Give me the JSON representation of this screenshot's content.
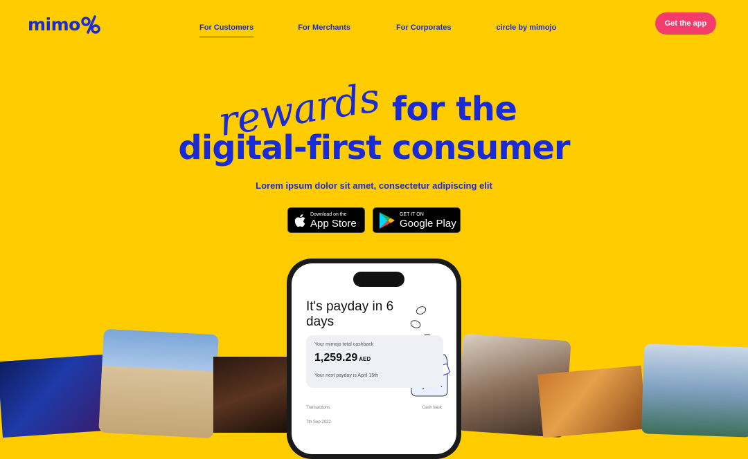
{
  "nav": {
    "logo_text": "mimo",
    "items": [
      {
        "label": "For Customers",
        "active": true
      },
      {
        "label": "For Merchants",
        "active": false
      },
      {
        "label": "For Corporates",
        "active": false
      },
      {
        "label": "circle by mimojo",
        "active": false
      }
    ],
    "cta_label": "Get the app"
  },
  "hero": {
    "script_word": "rewards",
    "line1": "for the",
    "line2": "digital-first consumer",
    "subtitle": "Lorem ipsum dolor sit amet, consectetur adipiscing elit"
  },
  "badges": {
    "apple": {
      "small": "Download on the",
      "big": "App Store",
      "icon": "apple-icon"
    },
    "google": {
      "small": "GET IT ON",
      "big": "Google Play",
      "icon": "google-play-icon"
    }
  },
  "phone": {
    "headline": "It's payday in 6 days",
    "card_label": "Your mimojo total cashback",
    "amount": "1,259.29",
    "currency": "AED",
    "next_payday": "Your next payday is April 15th",
    "tx_header_left": "Transactions",
    "tx_header_right": "Cash back",
    "tx_date": "7th Sep 2022"
  },
  "colors": {
    "background": "#FFCC00",
    "brand_blue": "#1a2bd6",
    "cta_pink": "#F23C6B"
  }
}
